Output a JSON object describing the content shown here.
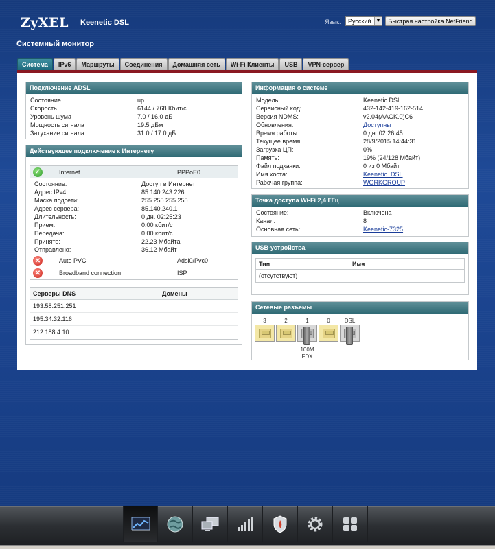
{
  "header": {
    "logo": "ZyXEL",
    "product": "Keenetic DSL",
    "lang_label": "Язык:",
    "lang_value": "Русский",
    "quick_setup": "Быстрая настройка NetFriend",
    "page_title": "Системный монитор"
  },
  "tabs": [
    "Система",
    "IPv6",
    "Маршруты",
    "Соединения",
    "Домашняя сеть",
    "Wi-Fi Клиенты",
    "USB",
    "VPN-сервер"
  ],
  "adsl": {
    "title": "Подключение ADSL",
    "rows": [
      {
        "k": "Состояние",
        "v": "up"
      },
      {
        "k": "Скорость",
        "v": "6144 / 768 Кбит/с"
      },
      {
        "k": "Уровень шума",
        "v": "7.0 / 16.0 дБ"
      },
      {
        "k": "Мощность сигнала",
        "v": "19.5 дБм"
      },
      {
        "k": "Затухание сигнала",
        "v": "31.0 / 17.0 дБ"
      }
    ]
  },
  "inet": {
    "title": "Действующее подключение к Интернету",
    "main_name": "Internet",
    "main_type": "PPPoE0",
    "rows": [
      {
        "k": "Состояние:",
        "v": "Доступ в Интернет"
      },
      {
        "k": "Адрес IPv4:",
        "v": "85.140.243.226"
      },
      {
        "k": "Маска подсети:",
        "v": "255.255.255.255"
      },
      {
        "k": "Адрес сервера:",
        "v": "85.140.240.1"
      },
      {
        "k": "Длительность:",
        "v": "0 дн. 02:25:23"
      },
      {
        "k": "Прием:",
        "v": "0.00 кбит/с"
      },
      {
        "k": "Передача:",
        "v": "0.00 кбит/с"
      },
      {
        "k": "Принято:",
        "v": "22.23 Мбайта"
      },
      {
        "k": "Отправлено:",
        "v": "36.12 Мбайт"
      }
    ],
    "others": [
      {
        "name": "Auto PVC",
        "type": "Adsl0/Pvc0"
      },
      {
        "name": "Broadband connection",
        "type": "ISP"
      }
    ],
    "dns_header": "Серверы DNS",
    "domains_header": "Домены",
    "dns": [
      "193.58.251.251",
      "195.34.32.116",
      "212.188.4.10"
    ]
  },
  "sysinfo": {
    "title": "Информация о системе",
    "rows": [
      {
        "k": "Модель:",
        "v": "Keenetic DSL"
      },
      {
        "k": "Сервисный код:",
        "v": "432-142-419-162-514"
      },
      {
        "k": "Версия NDMS:",
        "v": "v2.04(AAGK.0)C6"
      },
      {
        "k": "Обновления:",
        "v": "Доступны",
        "link": true
      },
      {
        "k": "Время работы:",
        "v": "0 дн. 02:26:45"
      },
      {
        "k": "Текущее время:",
        "v": "28/9/2015 14:44:31"
      },
      {
        "k": "Загрузка ЦП:",
        "v": "0%"
      },
      {
        "k": "Память:",
        "v": "19% (24/128 Мбайт)"
      },
      {
        "k": "Файл подкачки:",
        "v": "0 из 0 Мбайт"
      },
      {
        "k": "Имя хоста:",
        "v": "Keenetic_DSL",
        "link": true
      },
      {
        "k": "Рабочая группа:",
        "v": "WORKGROUP",
        "link": true
      }
    ]
  },
  "wifi": {
    "title": "Точка доступа Wi-Fi 2,4 ГГц",
    "rows": [
      {
        "k": "Состояние:",
        "v": "Включена"
      },
      {
        "k": "Канал:",
        "v": "8"
      },
      {
        "k": "Основная сеть:",
        "v": "Keenetic-7325",
        "link": true
      }
    ]
  },
  "usb": {
    "title": "USB-устройства",
    "col_type": "Тип",
    "col_name": "Имя",
    "empty": "(отсутствуют)"
  },
  "ports": {
    "title": "Сетевые разъемы",
    "labels": [
      "3",
      "2",
      "1",
      "0",
      "DSL"
    ],
    "speed": "100M",
    "duplex": "FDX"
  },
  "dock": {
    "icons": [
      "monitor-chart-icon",
      "globe-icon",
      "computers-icon",
      "signal-bars-icon",
      "shield-icon",
      "gear-icon",
      "apps-grid-icon"
    ],
    "active_index": 0
  }
}
